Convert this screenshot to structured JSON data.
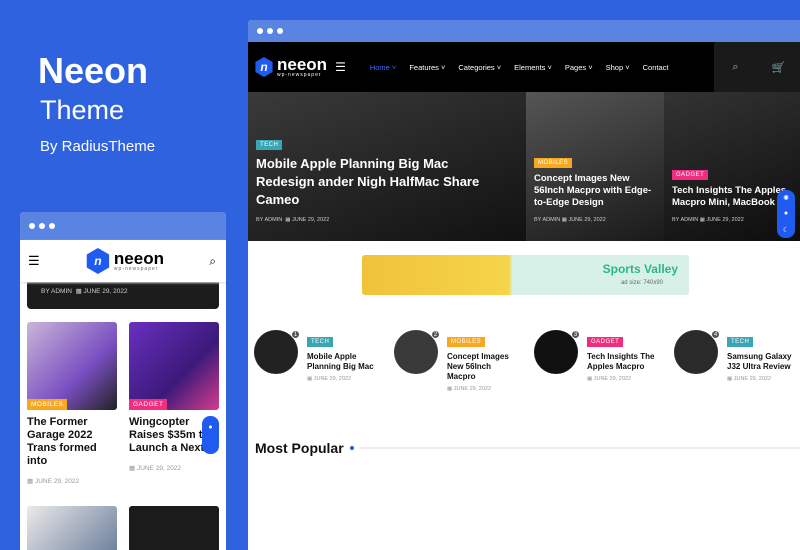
{
  "promo": {
    "brand": "Neeon",
    "subtitle": "Theme",
    "author": "By RadiusTheme"
  },
  "logo": {
    "name": "neeon",
    "tagline": "wp-newspaper"
  },
  "nav": [
    "Home",
    "Features",
    "Categories",
    "Elements",
    "Pages",
    "Shop",
    "Contact"
  ],
  "hero": [
    {
      "tag": "TECH",
      "title": "Mobile Apple Planning Big Mac Redesign ander Nigh HalfMac Share Cameo",
      "author": "BY ADMIN",
      "date": "JUNE 29, 2022"
    },
    {
      "tag": "MOBILES",
      "title": "Concept Images New 56Inch Macpro with Edge-to-Edge Design",
      "author": "BY ADMIN",
      "date": "JUNE 29, 2022"
    },
    {
      "tag": "GADGET",
      "title": "Tech Insights The Apples Macpro Mini, MacBook Air",
      "author": "BY ADMIN",
      "date": "JUNE 29, 2022"
    }
  ],
  "ad": {
    "title": "Sports Valley",
    "size": "ad size: 740x90"
  },
  "posts": [
    {
      "num": "1",
      "tag": "TECH",
      "title": "Mobile Apple Planning Big Mac",
      "date": "JUNE 29, 2022"
    },
    {
      "num": "2",
      "tag": "MOBILES",
      "title": "Concept Images New 56Inch Macpro",
      "date": "JUNE 29, 2022"
    },
    {
      "num": "3",
      "tag": "GADGET",
      "title": "Tech Insights The Apples Macpro",
      "date": "JUNE 29, 2022"
    },
    {
      "num": "4",
      "tag": "TECH",
      "title": "Samsung Galaxy J32 Ultra Review",
      "date": "JUNE 29, 2022"
    }
  ],
  "section": "Most Popular",
  "mobile": {
    "top_meta": {
      "author": "BY ADMIN",
      "date": "JUNE 29, 2022"
    },
    "cards": [
      {
        "tag": "MOBILES",
        "title": "The Former Garage 2022 Trans formed into",
        "date": "JUNE 29, 2022"
      },
      {
        "tag": "GADGET",
        "title": "Wingcopter Raises $35m to Launch a Next",
        "date": "JUNE 29, 2022"
      }
    ]
  },
  "colors": {
    "background": "#2f62de",
    "accent": "#1f5bf0",
    "tech": "#3aa6b4",
    "mobiles": "#f7a823",
    "gadget": "#f02e80"
  }
}
